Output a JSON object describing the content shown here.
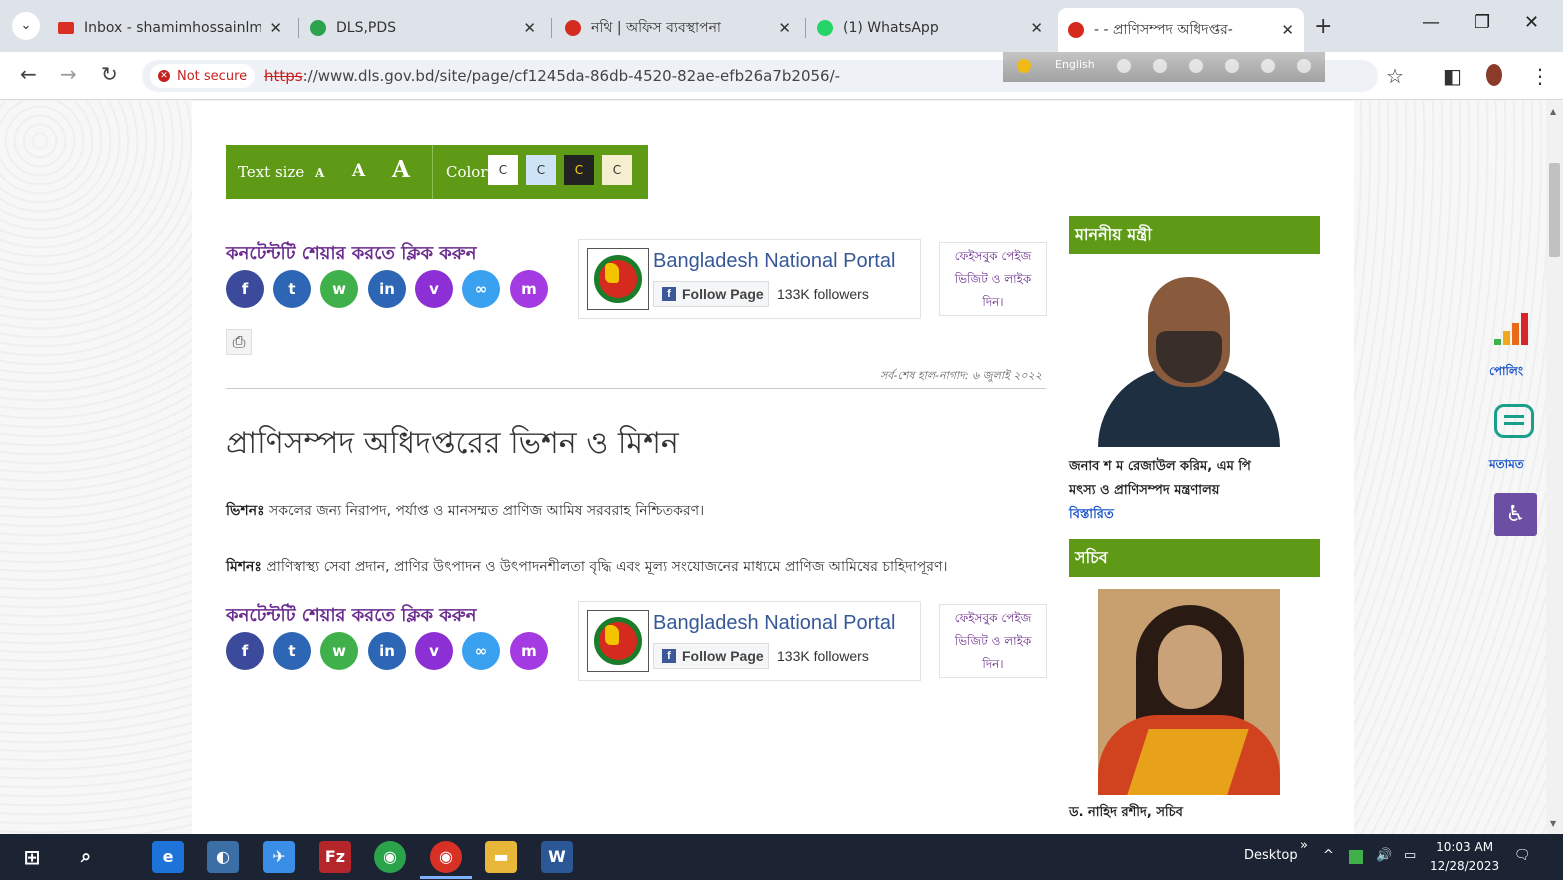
{
  "browser": {
    "tabs": [
      {
        "title": "Inbox - shamimhossainlms@",
        "favicon_color": "#d93025"
      },
      {
        "title": "DLS,PDS",
        "favicon_color": "#2aa34a"
      },
      {
        "title": "নথি | অফিস ব্যবস্থাপনা",
        "favicon_color": "#d52b1e"
      },
      {
        "title": "(1) WhatsApp",
        "favicon_color": "#25d366"
      },
      {
        "title": "- - প্রাণিসম্পদ অধিদপ্তর-",
        "favicon_color": "#d52b1e"
      }
    ],
    "security_label": "Not secure",
    "url_scheme": "https",
    "url_rest": "://www.dls.gov.bd/site/page/cf1245da-86db-4520-82ae-efb26a7b2056/-",
    "ext_language": "English"
  },
  "page": {
    "text_size_label": "Text size",
    "text_size_small": "A",
    "text_size_medium": "A",
    "text_size_large": "A",
    "color_label": "Color",
    "color_swatches": [
      {
        "letter": "C",
        "bg": "#ffffff",
        "fg": "#333333"
      },
      {
        "letter": "C",
        "bg": "#cfe3f6",
        "fg": "#333333"
      },
      {
        "letter": "C",
        "bg": "#222222",
        "fg": "#ffd400"
      },
      {
        "letter": "C",
        "bg": "#f5efcf",
        "fg": "#333333"
      }
    ],
    "share_title": "কনটেন্টটি শেয়ার করতে ক্লিক করুন",
    "social_buttons": [
      {
        "name": "facebook",
        "glyph": "f",
        "color": "#3b4a9a"
      },
      {
        "name": "twitter",
        "glyph": "t",
        "color": "#2d66b4"
      },
      {
        "name": "whatsapp",
        "glyph": "w",
        "color": "#3fb04a"
      },
      {
        "name": "linkedin",
        "glyph": "in",
        "color": "#2d66b4"
      },
      {
        "name": "viber",
        "glyph": "v",
        "color": "#8c2fd4"
      },
      {
        "name": "copy-link",
        "glyph": "∞",
        "color": "#3aa1f0"
      },
      {
        "name": "messenger",
        "glyph": "m",
        "color": "#a43be2"
      }
    ],
    "portal_name": "Bangladesh National Portal",
    "follow_label": "Follow Page",
    "followers": "133K followers",
    "fb_visit": [
      "ফেইসবুক পেইজ",
      "ভিজিট ও লাইক",
      "দিন।"
    ],
    "last_updated": "সর্ব-শেষ হাল-নাগাদ: ৬ জুলাই ২০২২",
    "heading": "প্রাণিসম্পদ অধিদপ্তরের ভিশন ও মিশন",
    "vision_label": "ভিশনঃ",
    "vision_text": "সকলের জন্য নিরাপদ, পর্যাপ্ত ও মানসম্মত প্রাণিজ আমিষ সরবরাহ নিশ্চিতকরণ।",
    "mission_label": "মিশনঃ",
    "mission_text": "প্রাণিস্বাস্থ্য সেবা প্রদান, প্রাণির উৎপাদন ও উৎপাদনশীলতা বৃদ্ধি এবং মূল্য সংযোজনের মাধ্যমে প্রাণিজ আমিষের চাহিদাপূরণ।"
  },
  "sidebar": {
    "minister_heading": "মাননীয় মন্ত্রী",
    "minister_name": "জনাব শ ম রেজাউল করিম, এম পি",
    "minister_ministry": "মৎস্য ও প্রাণিসম্পদ মন্ত্রণালয়",
    "details_link": "বিস্তারিত",
    "secretary_heading": "সচিব",
    "secretary_name": "ড. নাহিদ রশীদ, সচিব"
  },
  "floating": {
    "polling_label": "পোলিং",
    "opinion_label": "মতামত"
  },
  "taskbar": {
    "desktop_label": "Desktop",
    "time": "10:03 AM",
    "date": "12/28/2023"
  }
}
